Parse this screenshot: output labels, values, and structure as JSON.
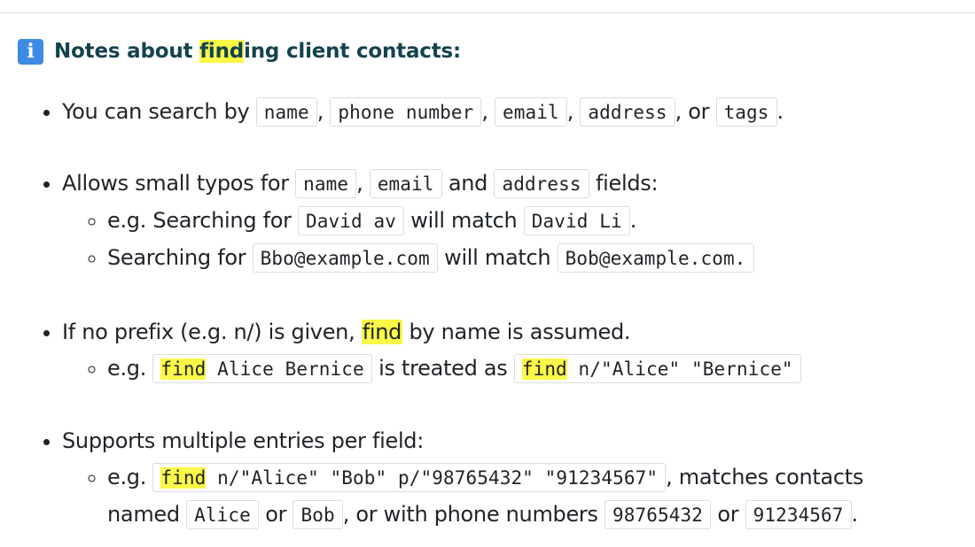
{
  "heading": {
    "icon": "info-icon",
    "pre": "Notes about ",
    "highlight": "find",
    "post": "ing client contacts:"
  },
  "bullets": [
    {
      "text1": "You can search by ",
      "code_name": "name",
      "sep1": ", ",
      "code_phone": "phone number",
      "sep2": ", ",
      "code_email": "email",
      "sep3": ", ",
      "code_address": "address",
      "sep4": ", or ",
      "code_tags": "tags",
      "end": "."
    },
    {
      "text1": "Allows small typos for ",
      "code_name": "name",
      "sep1": ", ",
      "code_email": "email",
      "sep2": " and ",
      "code_address": "address",
      "end": " fields:",
      "sub": [
        {
          "pre": "e.g. Searching for ",
          "code_a": "David av",
          "mid": " will match ",
          "code_b": "David Li",
          "end": "."
        },
        {
          "pre": "Searching for ",
          "code_a": "Bbo@example.com",
          "mid": " will match ",
          "code_b": "Bob@example.com.",
          "end": ""
        }
      ]
    },
    {
      "text1": "If no prefix (e.g. n/) is given, ",
      "highlight": "find",
      "end": " by name is assumed.",
      "sub": [
        {
          "pre": "e.g. ",
          "code_a_hl": "find",
          "code_a_rest": " Alice Bernice",
          "mid": " is treated as ",
          "code_b_hl": "find",
          "code_b_rest": " n/\"Alice\" \"Bernice\""
        }
      ]
    },
    {
      "text1": "Supports multiple entries per field:",
      "sub": [
        {
          "pre": "e.g. ",
          "code_a_hl": "find",
          "code_a_rest": " n/\"Alice\" \"Bob\" p/\"98765432\" \"91234567\"",
          "mid": ", matches contacts",
          "line2_pre": "named ",
          "code_alice": "Alice",
          "or1": " or ",
          "code_bob": "Bob",
          "mid2": ", or with phone numbers ",
          "code_p1": "98765432",
          "or2": " or ",
          "code_p2": "91234567",
          "end": "."
        }
      ]
    }
  ]
}
